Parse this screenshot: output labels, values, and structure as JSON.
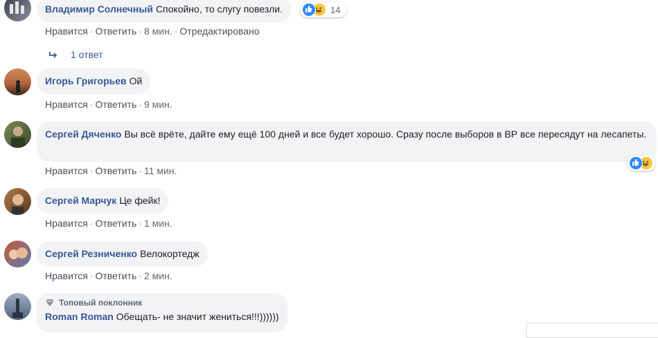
{
  "comments": [
    {
      "author": "Владимир Солнечный",
      "text": "Спокойно, то слугу повезли.",
      "actions": {
        "like": "Нравится",
        "reply": "Ответить",
        "time": "8 мин.",
        "edited": "Отредактировано"
      },
      "reactions": {
        "types": [
          "like-icon",
          "haha-icon"
        ],
        "count": "14"
      },
      "replies_label": "1 ответ"
    },
    {
      "author": "Игорь Григорьев",
      "text": "Ой",
      "actions": {
        "like": "Нравится",
        "reply": "Ответить",
        "time": "9 мин."
      }
    },
    {
      "author": "Сергей Дяченко",
      "text": "Вы всё врёте, дайте ему ещё 100 дней и все будет хорошо. Сразу после выборов в ВР все пересядут на лесапеты.",
      "actions": {
        "like": "Нравится",
        "reply": "Ответить",
        "time": "11 мин."
      },
      "reactions": {
        "types": [
          "like-icon",
          "haha-icon"
        ]
      }
    },
    {
      "author": "Сергей Марчук",
      "text": "Це фейк!",
      "actions": {
        "like": "Нравится",
        "reply": "Ответить",
        "time": "1 мин."
      }
    },
    {
      "author": "Сергей Резниченко",
      "text": "Велокортедж",
      "actions": {
        "like": "Нравится",
        "reply": "Ответить",
        "time": "2 мин."
      }
    },
    {
      "badge": "Топовый поклонник",
      "author": "Roman Roman",
      "text": "Обещать- не значит жениться!!!))))))"
    }
  ],
  "colors": {
    "author": "#385898",
    "bubble": "#f2f3f5",
    "like": "#2e89ff",
    "haha": "#f7c842"
  }
}
